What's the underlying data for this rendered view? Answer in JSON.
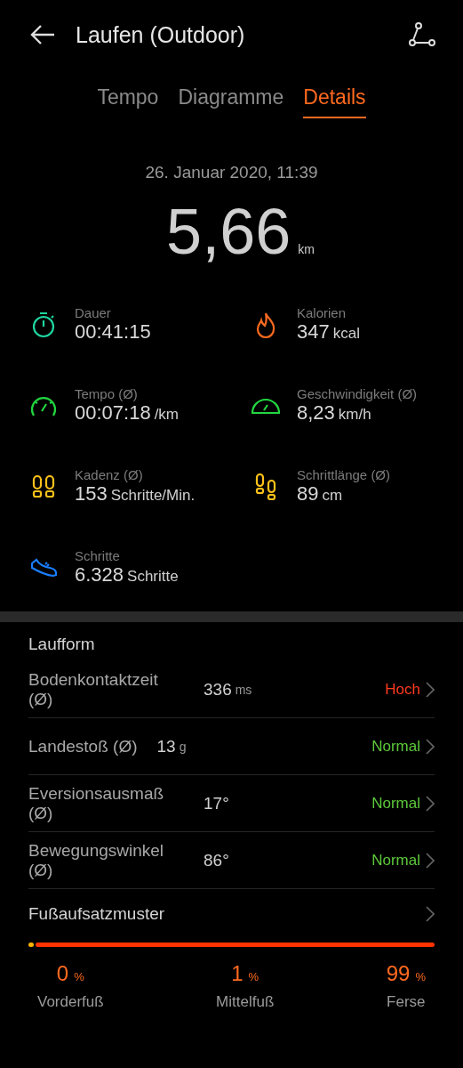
{
  "header": {
    "title": "Laufen (Outdoor)"
  },
  "tabs": [
    {
      "label": "Tempo",
      "selected": false
    },
    {
      "label": "Diagramme",
      "selected": false
    },
    {
      "label": "Details",
      "selected": true
    }
  ],
  "summary": {
    "date": "26. Januar 2020, 11:39",
    "distance": "5,66",
    "unit": "km"
  },
  "stats": [
    {
      "color": "#1fd6a0",
      "label": "Dauer",
      "value": "00:41:15"
    },
    {
      "color": "#ff6a1f",
      "label": "Kalorien",
      "value": "347",
      "unit": "kcal"
    },
    {
      "color": "#22d640",
      "label": "Tempo (Ø)",
      "value": "00:07:18",
      "unit": "/km"
    },
    {
      "color": "#22d640",
      "label": "Geschwindigkeit (Ø)",
      "value": "8,23",
      "unit": "km/h"
    },
    {
      "color": "#ffc21a",
      "label": "Kadenz (Ø)",
      "value": "153",
      "unit": "Schritte/Min."
    },
    {
      "color": "#ffc21a",
      "label": "Schrittlänge (Ø)",
      "value": "89",
      "unit": "cm"
    },
    {
      "color": "#1a7fff",
      "label": "Schritte",
      "value": "6.328",
      "unit": "Schritte"
    }
  ],
  "running_form": {
    "title": "Laufform",
    "rows": [
      {
        "label": "Bodenkontaktzeit (Ø)",
        "value": "336",
        "unit": "ms",
        "rating": "Hoch",
        "color": "#ff3b1f"
      },
      {
        "label": "Landestoß (Ø)",
        "value": "13",
        "unit": "g",
        "rating": "Normal",
        "color": "#5cc93a"
      },
      {
        "label": "Eversionsausmaß (Ø)",
        "value": "17°",
        "rating": "Normal",
        "color": "#5cc93a"
      },
      {
        "label": "Bewegungswinkel (Ø)",
        "value": "86°",
        "rating": "Normal",
        "color": "#5cc93a"
      }
    ]
  },
  "foot_strike": {
    "title": "Fußaufsatzmuster",
    "segments": [
      {
        "label": "Vorderfuß",
        "value": "0",
        "unit": "%"
      },
      {
        "label": "Mittelfuß",
        "value": "1",
        "unit": "%"
      },
      {
        "label": "Ferse",
        "value": "99",
        "unit": "%"
      }
    ]
  }
}
